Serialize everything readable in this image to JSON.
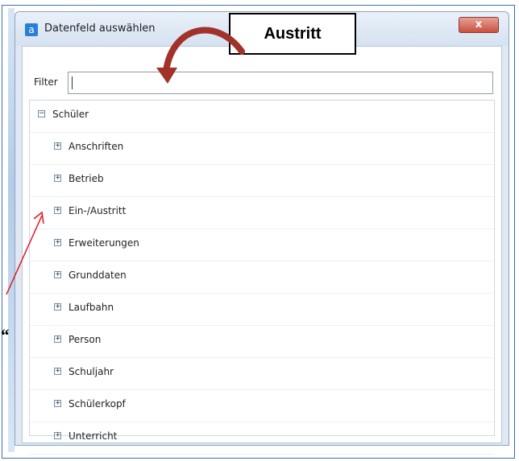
{
  "window": {
    "title": "Datenfeld auswählen",
    "close_glyph": "x",
    "app_icon_glyph": "a"
  },
  "filter": {
    "label": "Filter",
    "value": ""
  },
  "tree": {
    "root": {
      "label": "Schüler",
      "expander": "−"
    },
    "children": [
      {
        "label": "Anschriften",
        "expander": "+"
      },
      {
        "label": "Betrieb",
        "expander": "+"
      },
      {
        "label": "Ein-/Austritt",
        "expander": "+"
      },
      {
        "label": "Erweiterungen",
        "expander": "+"
      },
      {
        "label": "Grunddaten",
        "expander": "+"
      },
      {
        "label": "Laufbahn",
        "expander": "+"
      },
      {
        "label": "Person",
        "expander": "+"
      },
      {
        "label": "Schuljahr",
        "expander": "+"
      },
      {
        "label": "Schülerkopf",
        "expander": "+"
      },
      {
        "label": "Unterricht",
        "expander": "+"
      }
    ]
  },
  "annotation": {
    "callout_text": "Austritt",
    "quote_mark": "“"
  },
  "colors": {
    "curved_arrow": "#a0322a",
    "pointer_line": "#e0141e",
    "close_button": "#c9513f",
    "frame": "#3c6fb5"
  }
}
